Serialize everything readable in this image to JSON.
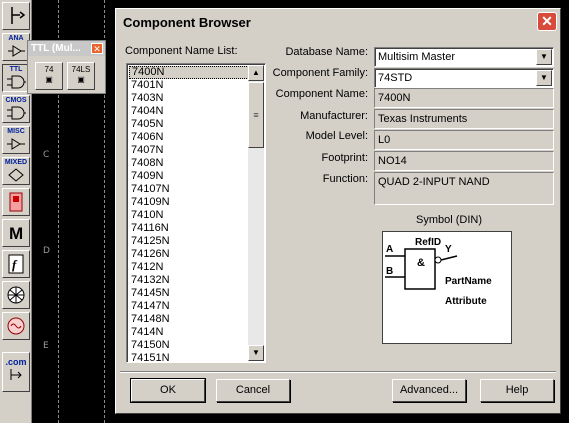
{
  "toolbar": {
    "buttons": [
      {
        "label": "",
        "icon": "pointer-icon"
      },
      {
        "label": "ANA",
        "icon": "analog-icon"
      },
      {
        "label": "TTL",
        "icon": "ttl-icon"
      },
      {
        "label": "CMOS",
        "icon": "cmos-icon"
      },
      {
        "label": "MISC",
        "icon": "misc-icon"
      },
      {
        "label": "MIXED",
        "icon": "mixed-icon"
      },
      {
        "label": "",
        "icon": "indicator-icon"
      },
      {
        "label": "M",
        "icon": "m-icon"
      },
      {
        "label": "",
        "icon": "function-icon"
      },
      {
        "label": "",
        "icon": "rf-icon"
      },
      {
        "label": "",
        "icon": "electromechanical-icon"
      },
      {
        "label": ".com",
        "icon": "com-icon"
      }
    ]
  },
  "workspace": {
    "zones": [
      "C",
      "D",
      "E"
    ]
  },
  "ttl_palette": {
    "title": "TTL (Mul...",
    "buttons": [
      {
        "label": "74"
      },
      {
        "label": "74LS"
      }
    ]
  },
  "dialog": {
    "title": "Component Browser",
    "list_label": "Component Name List:",
    "list_items": [
      "7400N",
      "7401N",
      "7403N",
      "7404N",
      "7405N",
      "7406N",
      "7407N",
      "7408N",
      "7409N",
      "74107N",
      "74109N",
      "7410N",
      "74116N",
      "74125N",
      "74126N",
      "7412N",
      "74132N",
      "74145N",
      "74147N",
      "74148N",
      "7414N",
      "74150N",
      "74151N"
    ],
    "selected_index": 0,
    "fields": {
      "database_name": {
        "label": "Database Name:",
        "value": "Multisim Master"
      },
      "component_family": {
        "label": "Component Family:",
        "value": "74STD"
      },
      "component_name": {
        "label": "Component Name:",
        "value": "7400N"
      },
      "manufacturer": {
        "label": "Manufacturer:",
        "value": "Texas Instruments"
      },
      "model_level": {
        "label": "Model Level:",
        "value": "L0"
      },
      "footprint": {
        "label": "Footprint:",
        "value": "NO14"
      },
      "function": {
        "label": "Function:",
        "value": "QUAD 2-INPUT NAND"
      }
    },
    "symbol": {
      "label": "Symbol (DIN)",
      "ref_id": "RefID",
      "pin_a": "A",
      "pin_b": "B",
      "pin_y": "Y",
      "gate": "&",
      "part_name": "PartName",
      "attribute": "Attribute"
    },
    "buttons": {
      "ok": "OK",
      "cancel": "Cancel",
      "advanced": "Advanced...",
      "help": "Help"
    }
  }
}
